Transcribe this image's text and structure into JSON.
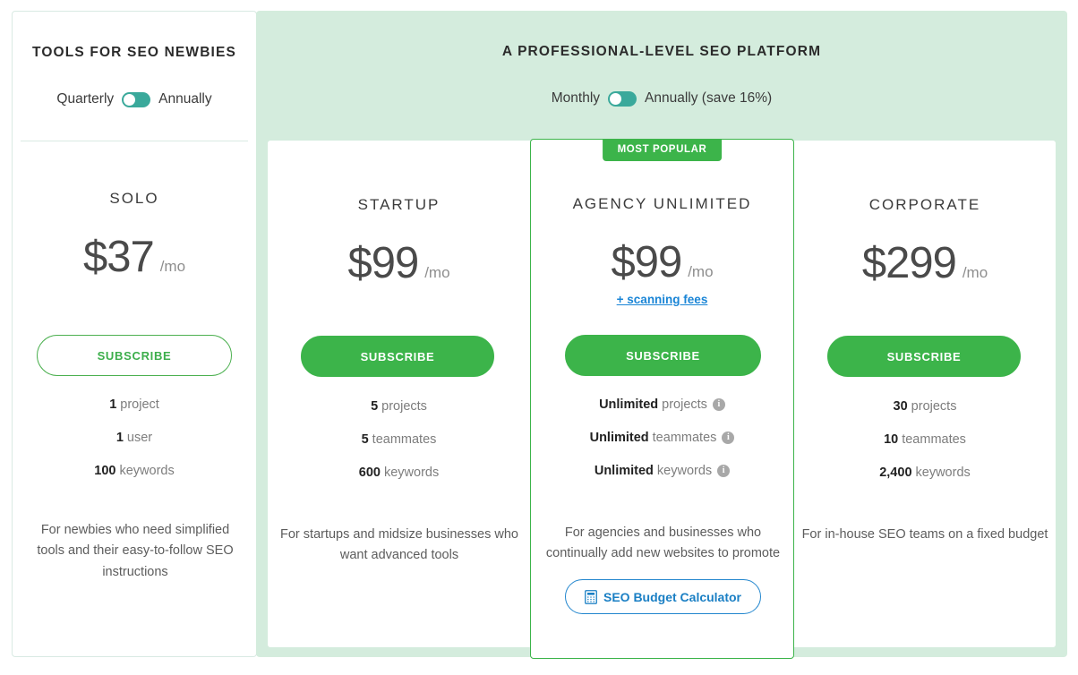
{
  "left_panel": {
    "title": "TOOLS FOR SEO NEWBIES",
    "billing_toggle": {
      "left_label": "Quarterly",
      "right_label": "Annually",
      "state": "annually",
      "accent_color": "#3aa99b"
    },
    "plan": {
      "name": "SOLO",
      "price": "$37",
      "period": "/mo",
      "cta_label": "SUBSCRIBE",
      "cta_style": "outline-green",
      "features": [
        {
          "value": "1",
          "label": "project",
          "info": false
        },
        {
          "value": "1",
          "label": "user",
          "info": false
        },
        {
          "value": "100",
          "label": "keywords",
          "info": false
        }
      ],
      "description": "For newbies who need simplified tools and their easy-to-follow SEO instructions"
    }
  },
  "right_panel": {
    "title": "A PROFESSIONAL-LEVEL SEO PLATFORM",
    "background_color": "#d4ecdd",
    "billing_toggle": {
      "left_label": "Monthly",
      "right_label": "Annually (save 16%)",
      "state": "annually",
      "accent_color": "#3aa99b"
    },
    "plans": [
      {
        "name": "STARTUP",
        "price": "$99",
        "period": "/mo",
        "note": null,
        "badge": null,
        "cta_label": "SUBSCRIBE",
        "cta_style": "solid-green",
        "features": [
          {
            "value": "5",
            "label": "projects",
            "info": false
          },
          {
            "value": "5",
            "label": "teammates",
            "info": false
          },
          {
            "value": "600",
            "label": "keywords",
            "info": false
          }
        ],
        "description": "For startups and midsize businesses who want advanced tools",
        "secondary_cta": null
      },
      {
        "name": "AGENCY UNLIMITED",
        "price": "$99",
        "period": "/mo",
        "note": "+ scanning fees",
        "badge": "MOST POPULAR",
        "cta_label": "SUBSCRIBE",
        "cta_style": "solid-green",
        "features": [
          {
            "value": "Unlimited",
            "label": "projects",
            "info": true
          },
          {
            "value": "Unlimited",
            "label": "teammates",
            "info": true
          },
          {
            "value": "Unlimited",
            "label": "keywords",
            "info": true
          }
        ],
        "description": "For agencies and businesses who continually add new websites to promote",
        "secondary_cta": {
          "label": "SEO Budget Calculator",
          "icon": "calculator-icon",
          "color": "#1a7fc4"
        }
      },
      {
        "name": "CORPORATE",
        "price": "$299",
        "period": "/mo",
        "note": null,
        "badge": null,
        "cta_label": "SUBSCRIBE",
        "cta_style": "solid-green",
        "features": [
          {
            "value": "30",
            "label": "projects",
            "info": false
          },
          {
            "value": "10",
            "label": "teammates",
            "info": false
          },
          {
            "value": "2,400",
            "label": "keywords",
            "info": false
          }
        ],
        "description": "For in-house SEO teams on a fixed budget",
        "secondary_cta": null
      }
    ]
  },
  "colors": {
    "green": "#3cb44a",
    "teal": "#3aa99b",
    "blue": "#1a7fc4",
    "mint_bg": "#d4ecdd"
  },
  "icons": {
    "info": "i",
    "calculator": "calculator-icon"
  }
}
